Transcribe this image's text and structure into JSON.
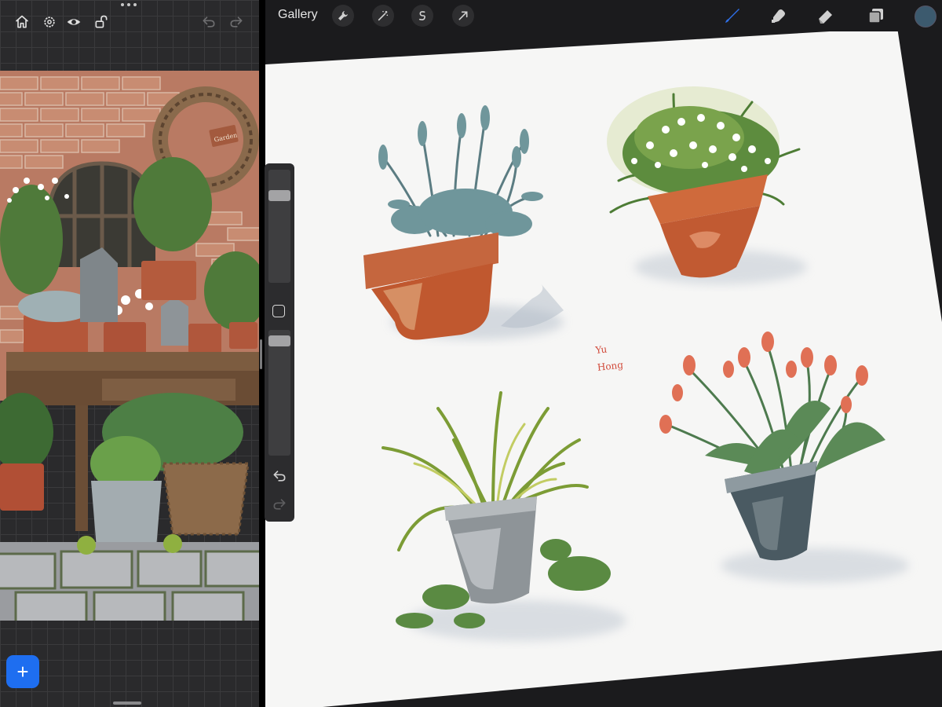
{
  "left_toolbar": {
    "icons": [
      "home-icon",
      "settings-icon",
      "eye-icon",
      "unlock-icon",
      "undo-icon",
      "redo-icon"
    ]
  },
  "reference": {
    "photo_subject": "potted plants garden scene",
    "sign_text": "Garden"
  },
  "add_button": {
    "label": "+"
  },
  "toolbar": {
    "gallery_label": "Gallery",
    "action_icons": [
      "wrench-icon",
      "magic-wand-icon",
      "selection-icon",
      "transform-arrow-icon"
    ],
    "tool_icons": [
      "brush-icon",
      "smudge-icon",
      "eraser-icon",
      "layers-icon"
    ],
    "active_tool": "brush-icon",
    "active_color": "#3c5a6e",
    "brush_color": "#2f6fe8"
  },
  "sidebar": {
    "brush_size": 0.8,
    "brush_opacity": 0.95,
    "icons": [
      "modify-square-icon",
      "undo-icon",
      "redo-icon"
    ]
  },
  "artwork": {
    "signature": [
      "Yu",
      "Hong"
    ],
    "plants": [
      "lavender-terracotta-pot",
      "white-flowers-terracotta-pot",
      "grass-metal-bucket",
      "tulips-metal-bucket"
    ]
  }
}
